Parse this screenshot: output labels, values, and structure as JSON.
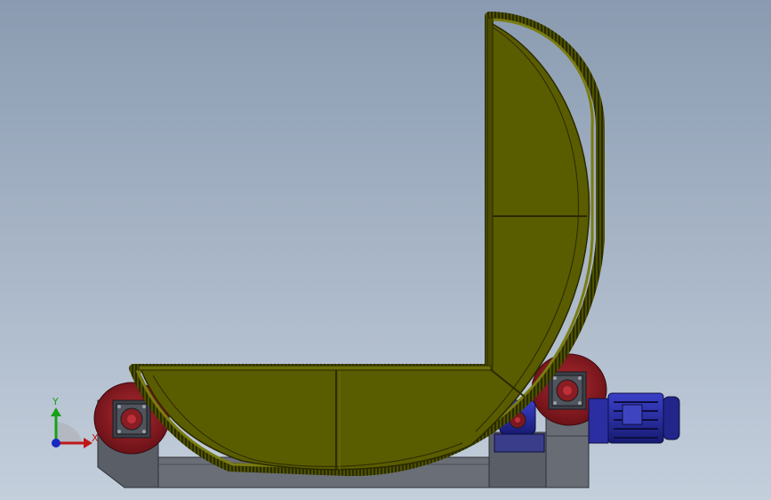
{
  "viewport": {
    "background_top": "#8a9bb1",
    "background_bottom": "#c4cfdc"
  },
  "model": {
    "fixture_color": "#5a5c00",
    "fixture_edge": "#2a2a00",
    "frame_color": "#6a6e76",
    "roller_color": "#8a1d24",
    "motor_color": "#2a2ea0"
  },
  "triad": {
    "y_label": "Y",
    "x_label": "X",
    "x_color": "#c01818",
    "y_color": "#18a018",
    "z_color": "#1828c0",
    "icon": "coordinate-triad-icon"
  }
}
